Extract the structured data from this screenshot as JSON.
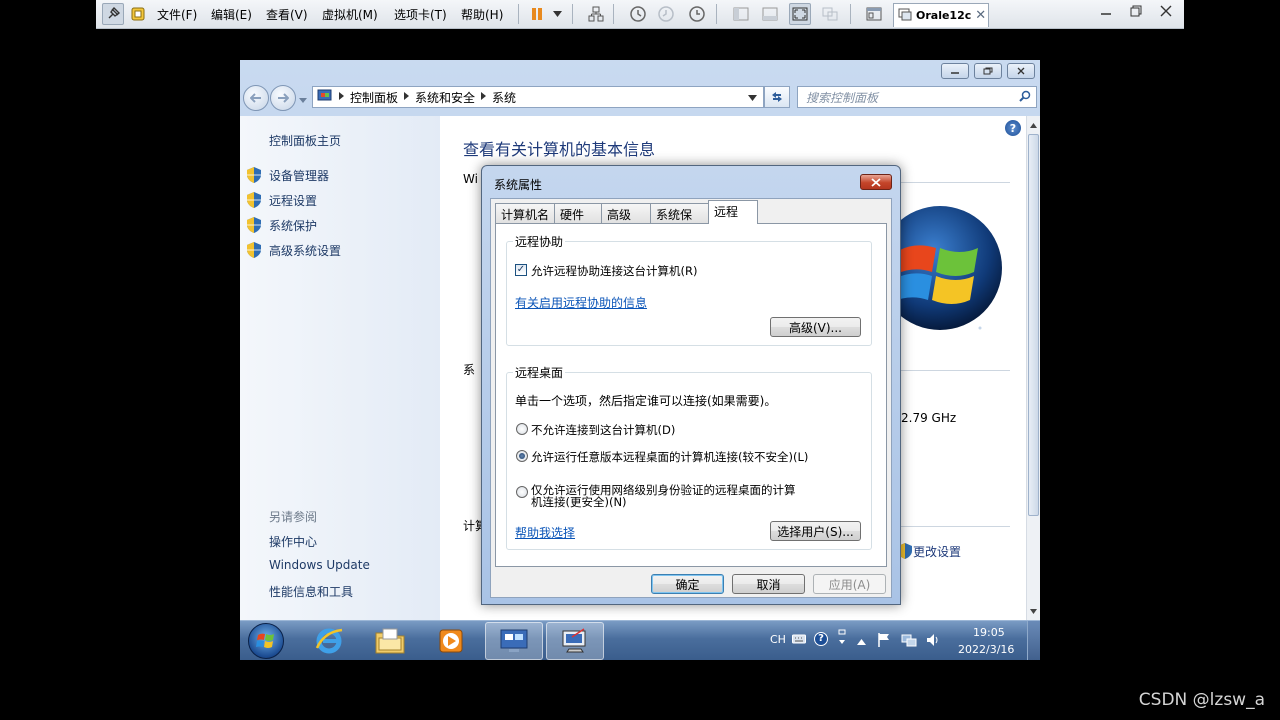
{
  "host": {
    "menus": [
      "文件(F)",
      "编辑(E)",
      "查看(V)",
      "虚拟机(M)",
      "选项卡(T)",
      "帮助(H)"
    ],
    "vm_tab": "Orale12c",
    "close_glyph": "✕"
  },
  "explorer": {
    "breadcrumbs": [
      "控制面板",
      "系统和安全",
      "系统"
    ],
    "search_placeholder": "搜索控制面板",
    "left_pane": {
      "home": "控制面板主页",
      "tasks": [
        "设备管理器",
        "远程设置",
        "系统保护",
        "高级系统设置"
      ],
      "see_also_title": "另请参阅",
      "see_also": [
        "操作中心",
        "Windows Update",
        "性能信息和工具"
      ]
    },
    "content": {
      "title": "查看有关计算机的基本信息",
      "win_fragment": "Wi",
      "sys_fragment": "系",
      "comp_fragment": "计算",
      "cpu_speed": "2.79 GHz",
      "change_settings": "更改设置"
    }
  },
  "dialog": {
    "title": "系统属性",
    "tabs": [
      "计算机名",
      "硬件",
      "高级",
      "系统保护",
      "远程"
    ],
    "active_tab": "远程",
    "remote_assistance": {
      "group_title": "远程协助",
      "allow_label": "允许远程协助连接这台计算机(R)",
      "allow_checked": true,
      "info_link": "有关启用远程协助的信息",
      "advanced_button": "高级(V)..."
    },
    "remote_desktop": {
      "group_title": "远程桌面",
      "instruction": "单击一个选项，然后指定谁可以连接(如果需要)。",
      "options": [
        "不允许连接到这台计算机(D)",
        "允许运行任意版本远程桌面的计算机连接(较不安全)(L)",
        "仅允许运行使用网络级别身份验证的远程桌面的计算",
        "机连接(更安全)(N)"
      ],
      "selected_index": 1,
      "help_link": "帮助我选择",
      "select_users_button": "选择用户(S)..."
    },
    "buttons": {
      "ok": "确定",
      "cancel": "取消",
      "apply": "应用(A)"
    }
  },
  "taskbar": {
    "lang": "CH",
    "time": "19:05",
    "date": "2022/3/16"
  },
  "watermark": "CSDN @lzsw_a",
  "colors": {
    "link": "#0b55b8",
    "title_blue": "#1e3a7a",
    "taskbar": "#4a6e9d"
  }
}
